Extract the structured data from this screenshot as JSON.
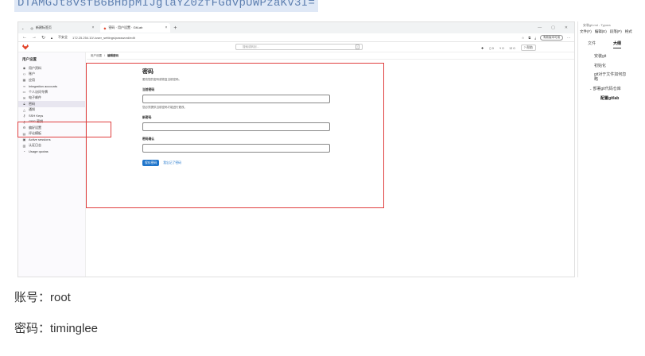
{
  "top_code": "DTAMGJt8vsfB6BHbpMIJglaYZ0zfFGdvpUWPzaKV3I=",
  "browser": {
    "tabs": [
      {
        "label": "新建标签页"
      },
      {
        "label": "密码 · 用户设置 · GitLab"
      }
    ],
    "url": "172.25.254.10/-/user_settings/password/edit",
    "insecure_label": "不安全",
    "update_button": "有新版本可用"
  },
  "gitlab": {
    "search_placeholder": "搜索或转到…",
    "search_shortcut": "/",
    "counts": {
      "issues": "0",
      "mrs": "0",
      "todos": "0"
    },
    "help_button": "帮助"
  },
  "sidebar": {
    "title": "用户设置",
    "items": [
      {
        "label": "用户资料",
        "icon": "user-icon"
      },
      {
        "label": "账户",
        "icon": "account-icon"
      },
      {
        "label": "应用",
        "icon": "apps-icon"
      },
      {
        "label": "Integration accounts",
        "icon": "link-icon"
      },
      {
        "label": "个人访问令牌",
        "icon": "token-icon"
      },
      {
        "label": "电子邮件",
        "icon": "mail-icon"
      },
      {
        "label": "密码",
        "icon": "lock-icon"
      },
      {
        "label": "通知",
        "icon": "bell-icon"
      },
      {
        "label": "SSH Keys",
        "icon": "key-icon"
      },
      {
        "label": "GPG 密钥",
        "icon": "key-icon"
      },
      {
        "label": "偏好设置",
        "icon": "settings-icon"
      },
      {
        "label": "评论模板",
        "icon": "comment-icon"
      },
      {
        "label": "Active sessions",
        "icon": "monitor-icon"
      },
      {
        "label": "认证日志",
        "icon": "log-icon"
      },
      {
        "label": "Usage quotas",
        "icon": "quota-icon"
      }
    ]
  },
  "breadcrumb": {
    "parent": "用户设置",
    "current": "编辑密码"
  },
  "form": {
    "title": "密码",
    "description": "更改您的密码或恢复当前密码。",
    "current_label": "当前密码",
    "current_hint": "您必须提供当前密码才能进行更改。",
    "new_label": "新密码",
    "confirm_label": "密码确认",
    "save_button": "保存密码",
    "forgot_link": "我忘记了密码"
  },
  "typora": {
    "window_title": "安装git.md - Typora",
    "menu": [
      "文件(F)",
      "编辑(E)",
      "段落(P)",
      "格式"
    ],
    "tab_files": "文件",
    "tab_outline": "大纲",
    "outline": [
      {
        "label": "安装git",
        "level": 1
      },
      {
        "label": "初始化",
        "level": 1
      },
      {
        "label": "git对于文件如何忽略",
        "level": 1
      },
      {
        "label": "部署git代码仓库",
        "level": 1
      },
      {
        "label": "配置gitlab",
        "level": 2
      }
    ]
  },
  "notes": {
    "account": "账号：root",
    "password": "密码：timinglee"
  },
  "colors": {
    "annotation_red": "#e04040",
    "gitlab_blue": "#1f75cb"
  }
}
